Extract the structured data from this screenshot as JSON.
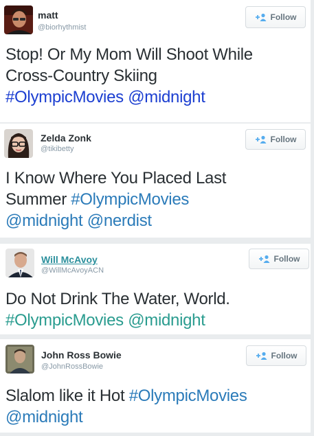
{
  "colors": {
    "background": "#e9ecee",
    "card": "#ffffff",
    "text": "#292f33",
    "handle": "#8899a6",
    "link_blue": "#1c3fd1",
    "link_default": "#2b7bb9",
    "link_teal": "#2a9c8f",
    "follow_icon": "#55acee"
  },
  "follow_label": "Follow",
  "tweets": [
    {
      "name": "matt",
      "handle": "@biorhythmist",
      "avatar_icon": "user-avatar-icon",
      "link_color": "#1c3fd1",
      "lines": [
        [
          {
            "text": "Stop! Or My Mom Will Shoot While",
            "link": false
          }
        ],
        [
          {
            "text": "Cross-Country Skiing",
            "link": false
          }
        ],
        [
          {
            "text": "#OlympicMovies",
            "link": true
          },
          {
            "text": " ",
            "link": false
          },
          {
            "text": "@midnight",
            "link": true
          }
        ]
      ]
    },
    {
      "name": "Zelda Zonk",
      "handle": "@tikibetty",
      "avatar_icon": "user-avatar-icon",
      "link_color": "#2b7bb9",
      "lines": [
        [
          {
            "text": "I Know Where You Placed Last",
            "link": false
          }
        ],
        [
          {
            "text": "Summer ",
            "link": false
          },
          {
            "text": "#OlympicMovies",
            "link": true
          }
        ],
        [
          {
            "text": "@midnight",
            "link": true
          },
          {
            "text": " ",
            "link": false
          },
          {
            "text": "@nerdist",
            "link": true
          }
        ]
      ]
    },
    {
      "name": "Will McAvoy",
      "handle": "@WillMcAvoyACN",
      "avatar_icon": "user-avatar-icon",
      "link_color": "#2a9c8f",
      "lines": [
        [
          {
            "text": "Do Not Drink The Water, World.",
            "link": false
          }
        ],
        [
          {
            "text": "#OlympicMovies",
            "link": true
          },
          {
            "text": " ",
            "link": false
          },
          {
            "text": "@midnight",
            "link": true
          }
        ]
      ]
    },
    {
      "name": "John Ross Bowie",
      "handle": "@JohnRossBowie",
      "avatar_icon": "user-avatar-icon",
      "link_color": "#2b7bb9",
      "lines": [
        [
          {
            "text": "Slalom like it Hot ",
            "link": false
          },
          {
            "text": "#OlympicMovies",
            "link": true
          }
        ],
        [
          {
            "text": "@midnight",
            "link": true
          }
        ]
      ]
    }
  ]
}
